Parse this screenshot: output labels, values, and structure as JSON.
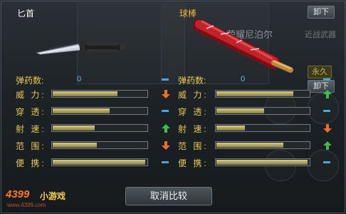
{
  "left": {
    "name": "匕首",
    "ammo_label": "弹药数:",
    "ammo_value": "0",
    "stats": [
      {
        "label": "威 力:",
        "value": 0.68,
        "indicator": "down"
      },
      {
        "label": "穿 透:",
        "value": 0.6,
        "indicator": "none"
      },
      {
        "label": "射 速:",
        "value": 0.44,
        "indicator": "up"
      },
      {
        "label": "范 围:",
        "value": 0.46,
        "indicator": "down"
      },
      {
        "label": "便 携:",
        "value": 0.97,
        "indicator": "none"
      }
    ]
  },
  "right": {
    "name": "球棒",
    "weapon_ghost_name": "荣耀尼泊尔",
    "category_ghost": "近战武器",
    "unload_top": "卸下",
    "unload_second": "卸下",
    "permanent_tag": "永久",
    "ammo_label": "弹药数:",
    "ammo_value": "0",
    "stats": [
      {
        "label": "威 力:",
        "value": 0.82,
        "indicator": "up"
      },
      {
        "label": "穿 透:",
        "value": 0.51,
        "indicator": "none"
      },
      {
        "label": "射 速:",
        "value": 0.3,
        "indicator": "down"
      },
      {
        "label": "范 围:",
        "value": 0.71,
        "indicator": "up"
      },
      {
        "label": "便 携:",
        "value": 0.97,
        "indicator": "none"
      }
    ]
  },
  "cancel_label": "取消比较",
  "watermark": {
    "brand": "4399",
    "sub": "小游戏",
    "url": "www.4399.com"
  },
  "colors": {
    "arrow_up": "#3bbf4a",
    "arrow_down": "#f07020",
    "dash": "#4aa6d6"
  }
}
